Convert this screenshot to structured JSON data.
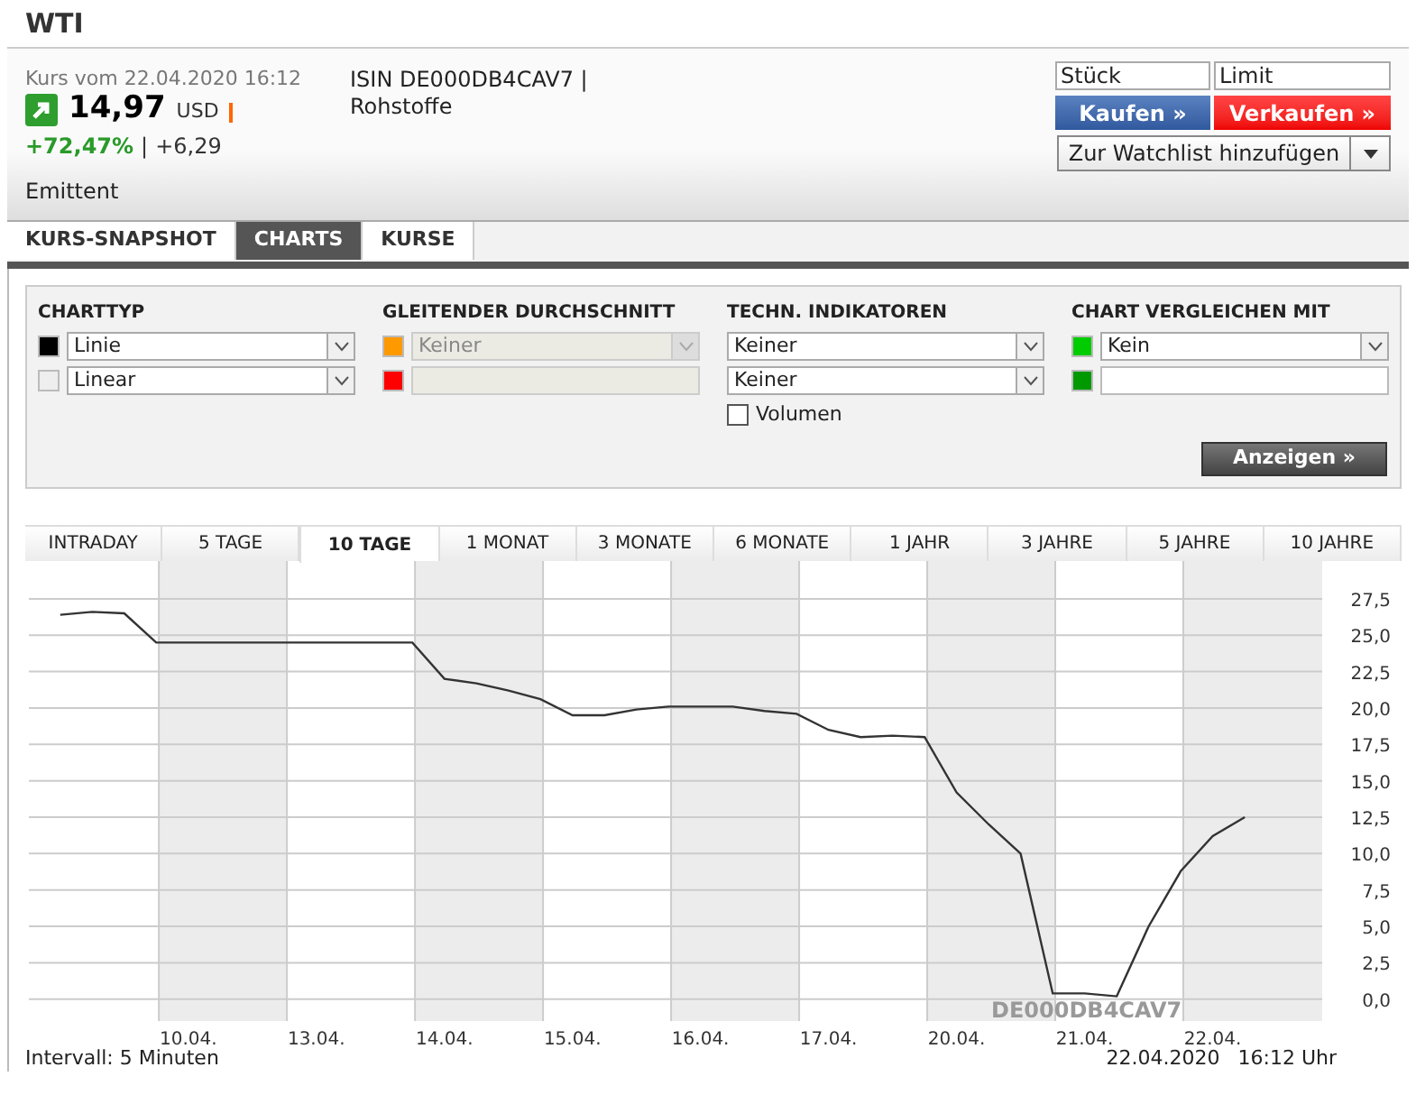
{
  "title": "WTI",
  "quote": {
    "timestamp": "Kurs vom 22.04.2020 16:12",
    "price": "14,97",
    "currency": "USD",
    "change_percent": "+72,47%",
    "separator": "|",
    "change_abs": "+6,29",
    "issuer_label": "Emittent"
  },
  "instrument": {
    "isin": "ISIN DE000DB4CAV7 |",
    "category": "Rohstoffe"
  },
  "order": {
    "quantity_placeholder": "Stück",
    "limit_placeholder": "Limit",
    "buy": "Kaufen »",
    "sell": "Verkaufen »",
    "watchlist": "Zur Watchlist hinzufügen"
  },
  "tabs": [
    {
      "label": "KURS-SNAPSHOT",
      "selected": false
    },
    {
      "label": "CHARTS",
      "selected": true
    },
    {
      "label": "KURSE",
      "selected": false
    }
  ],
  "chart_settings": {
    "groups": [
      {
        "heading": "CHARTTYP",
        "rows": [
          {
            "kind": "select",
            "color": "#000000",
            "value": "Linie",
            "disabled": false
          },
          {
            "kind": "select",
            "color": "#eeeeee",
            "value": "Linear",
            "disabled": false
          }
        ]
      },
      {
        "heading": "GLEITENDER DURCHSCHNITT",
        "rows": [
          {
            "kind": "select",
            "color": "#ff9900",
            "value": "Keiner",
            "disabled": true
          },
          {
            "kind": "input",
            "color": "#ff0000",
            "disabled": true
          }
        ]
      },
      {
        "heading": "TECHN. INDIKATOREN",
        "rows": [
          {
            "kind": "select",
            "value": "Keiner",
            "disabled": false
          },
          {
            "kind": "select",
            "value": "Keiner",
            "disabled": false
          },
          {
            "kind": "checkbox",
            "label": "Volumen",
            "checked": false
          }
        ]
      },
      {
        "heading": "CHART VERGLEICHEN MIT",
        "rows": [
          {
            "kind": "select",
            "color": "#00cc00",
            "value": "Kein",
            "disabled": false
          },
          {
            "kind": "input",
            "color": "#009900",
            "disabled": false
          }
        ]
      }
    ],
    "button": "Anzeigen »"
  },
  "periods": [
    {
      "label": "INTRADAY",
      "selected": false
    },
    {
      "label": "5 TAGE",
      "selected": false
    },
    {
      "label": "10 TAGE",
      "selected": true
    },
    {
      "label": "1 MONAT",
      "selected": false
    },
    {
      "label": "3 MONATE",
      "selected": false
    },
    {
      "label": "6 MONATE",
      "selected": false
    },
    {
      "label": "1 JAHR",
      "selected": false
    },
    {
      "label": "3 JAHRE",
      "selected": false
    },
    {
      "label": "5 JAHRE",
      "selected": false
    },
    {
      "label": "10 JAHRE",
      "selected": false
    }
  ],
  "chart_data": {
    "type": "line",
    "categories": [
      null,
      null,
      null,
      null,
      "10.04.",
      null,
      null,
      null,
      "13.04.",
      null,
      null,
      null,
      "14.04.",
      null,
      null,
      null,
      "15.04.",
      null,
      null,
      null,
      "16.04.",
      null,
      null,
      null,
      "17.04.",
      null,
      null,
      null,
      "20.04.",
      null,
      null,
      null,
      "21.04.",
      null,
      null,
      null,
      "22.04.",
      null,
      null
    ],
    "series": [
      {
        "color": "#333333",
        "values": [
          26.4,
          26.6,
          26.5,
          24.5,
          24.5,
          24.5,
          24.5,
          24.5,
          24.5,
          24.5,
          24.5,
          24.5,
          22.0,
          21.7,
          21.2,
          20.6,
          19.5,
          19.5,
          19.9,
          20.1,
          20.1,
          20.1,
          19.8,
          19.6,
          18.5,
          18.0,
          18.1,
          18.0,
          14.2,
          12.0,
          10.0,
          0.4,
          0.4,
          0.2,
          5.0,
          8.8,
          11.2,
          12.5,
          null
        ]
      }
    ],
    "grid": true,
    "ylim": [
      0,
      27.5
    ],
    "yticks": [
      {
        "value": 0,
        "label": "0,0"
      },
      {
        "value": 2.5,
        "label": "2,5"
      },
      {
        "value": 5,
        "label": "5,0"
      },
      {
        "value": 7.5,
        "label": "7,5"
      },
      {
        "value": 10,
        "label": "10,0"
      },
      {
        "value": 12.5,
        "label": "12,5"
      },
      {
        "value": 15,
        "label": "15,0"
      },
      {
        "value": 17.5,
        "label": "17,5"
      },
      {
        "value": 20,
        "label": "20,0"
      },
      {
        "value": 22.5,
        "label": "22,5"
      },
      {
        "value": 25,
        "label": "25,0"
      },
      {
        "value": 27.5,
        "label": "27,5"
      }
    ],
    "annotations": [
      "DE000DB4CAV7"
    ]
  },
  "footer": {
    "interval": "Intervall: 5 Minuten",
    "date": "22.04.2020",
    "time": "16:12 Uhr"
  }
}
